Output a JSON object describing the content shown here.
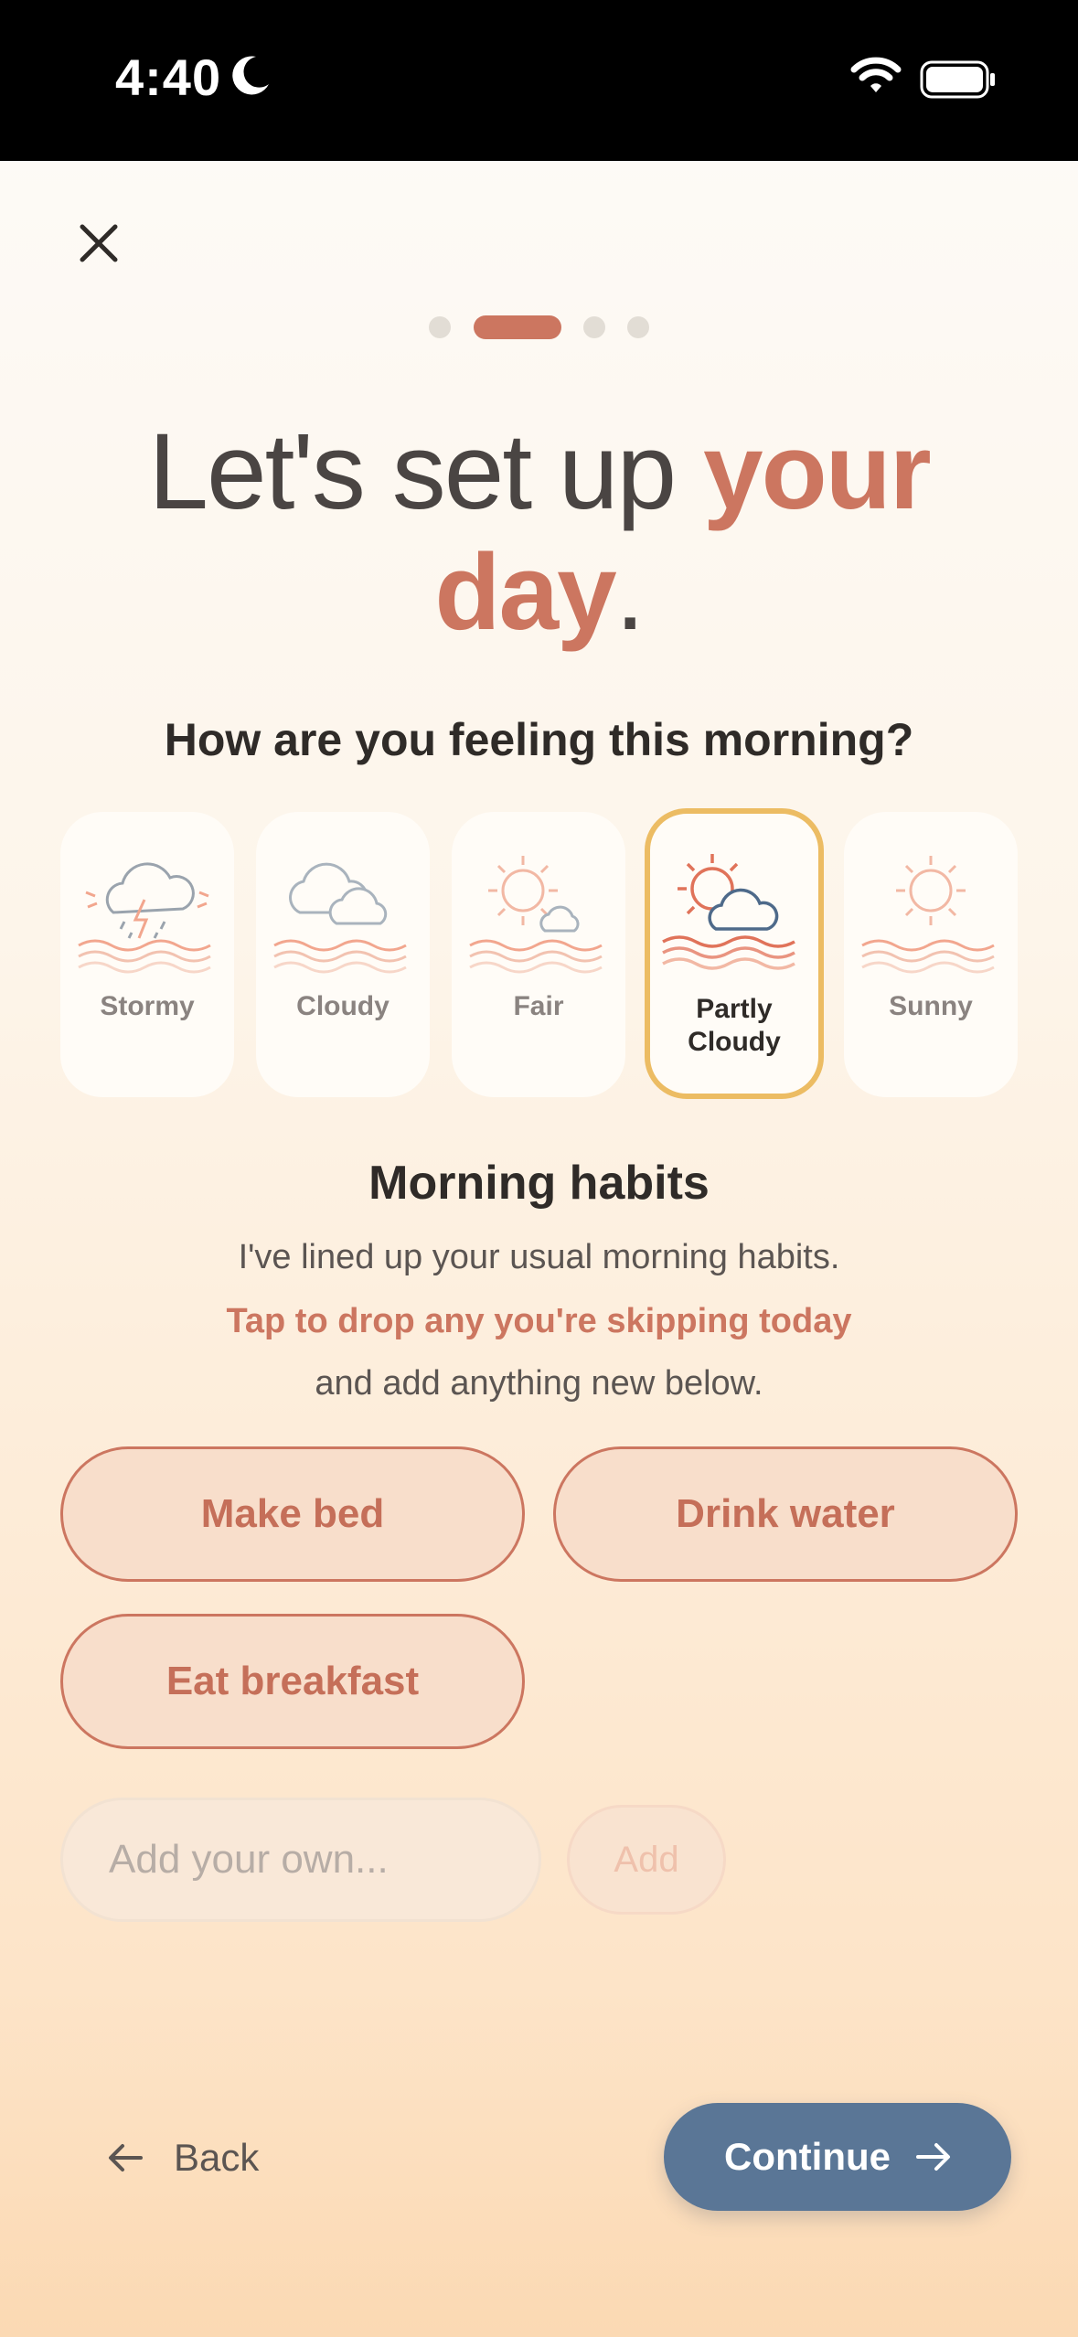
{
  "status_bar": {
    "time": "4:40"
  },
  "headline": {
    "part1": "Let's set up ",
    "accent1": "your",
    "accent2": "day",
    "end": "."
  },
  "question": "How are you feeling this morning?",
  "weather_options": [
    {
      "label": "Stormy",
      "selected": false
    },
    {
      "label": "Cloudy",
      "selected": false
    },
    {
      "label": "Fair",
      "selected": false
    },
    {
      "label_line1": "Partly",
      "label_line2": "Cloudy",
      "selected": true
    },
    {
      "label": "Sunny",
      "selected": false
    }
  ],
  "habits": {
    "title": "Morning habits",
    "desc_line1": "I've lined up your usual morning habits.",
    "desc_line2": "Tap to drop any you're skipping today",
    "desc_line3": "and add anything new below.",
    "items": [
      "Make bed",
      "Drink water",
      "Eat breakfast"
    ],
    "input_placeholder": "Add your own...",
    "add_label": "Add"
  },
  "footer": {
    "back_label": "Back",
    "continue_label": "Continue"
  },
  "progress": {
    "steps": 4,
    "current": 2
  },
  "colors": {
    "accent": "#cc7660",
    "primary": "#5a7696",
    "selected_border": "#ecbc63"
  }
}
